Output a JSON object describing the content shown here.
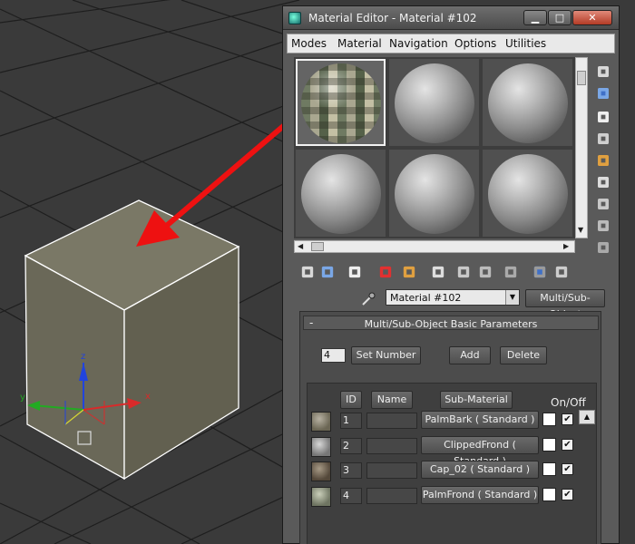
{
  "window": {
    "title": "Material Editor - Material #102",
    "minimize": "▁",
    "maximize": "□",
    "close": "✕"
  },
  "menu": [
    "Modes",
    "Material",
    "Navigation",
    "Options",
    "Utilities"
  ],
  "slots": [
    {
      "type": "multi-sub",
      "selected": true
    },
    {
      "type": "standard",
      "selected": false
    },
    {
      "type": "standard",
      "selected": false
    },
    {
      "type": "standard",
      "selected": false
    },
    {
      "type": "standard",
      "selected": false
    },
    {
      "type": "standard",
      "selected": false
    }
  ],
  "side_tools": [
    "sample-type-sphere-icon",
    "backlight-icon",
    "background-checker-icon",
    "sample-uv-tiling-icon",
    "video-color-check-icon",
    "make-preview-icon",
    "options-icon",
    "select-by-material-icon",
    "material-map-navigator-icon"
  ],
  "bottom_tools": [
    "get-material-icon",
    "put-to-scene-icon",
    "assign-to-selection-icon",
    "reset-map-icon",
    "make-unique-icon",
    "put-to-library-icon",
    "material-id-channel-icon",
    "show-map-in-viewport-icon",
    "show-end-result-icon",
    "go-to-parent-icon",
    "go-forward-to-sibling-icon"
  ],
  "material": {
    "name": "Material #102",
    "type": "Multi/Sub-Object"
  },
  "rollout": {
    "minus": "-",
    "title": "Multi/Sub-Object Basic Parameters",
    "number": "4",
    "set_number": "Set Number",
    "add": "Add",
    "delete": "Delete"
  },
  "columns": {
    "id": "ID",
    "name": "Name",
    "sub_material": "Sub-Material",
    "on_off": "On/Off"
  },
  "rows": [
    {
      "id": "1",
      "name": "",
      "sub_material": "PalmBark  ( Standard )",
      "on": true
    },
    {
      "id": "2",
      "name": "",
      "sub_material": "ClippedFrond  ( Standard )",
      "on": true
    },
    {
      "id": "3",
      "name": "",
      "sub_material": "Cap_02  ( Standard )",
      "on": true
    },
    {
      "id": "4",
      "name": "",
      "sub_material": "PalmFrond  ( Standard )",
      "on": true
    }
  ],
  "checkmark": "✔",
  "gizmo": {
    "x": "x",
    "y": "y",
    "z": "z"
  },
  "colors": {
    "viewport_bg": "#3a3a3a",
    "grid": "#1e1e1e",
    "box_face": "#6f6d5d",
    "box_edge": "#ffffff",
    "arrow": "#ee1111",
    "gizmo_x": "#d92a2a",
    "gizmo_y": "#22aa22",
    "gizmo_z": "#2244dd"
  }
}
